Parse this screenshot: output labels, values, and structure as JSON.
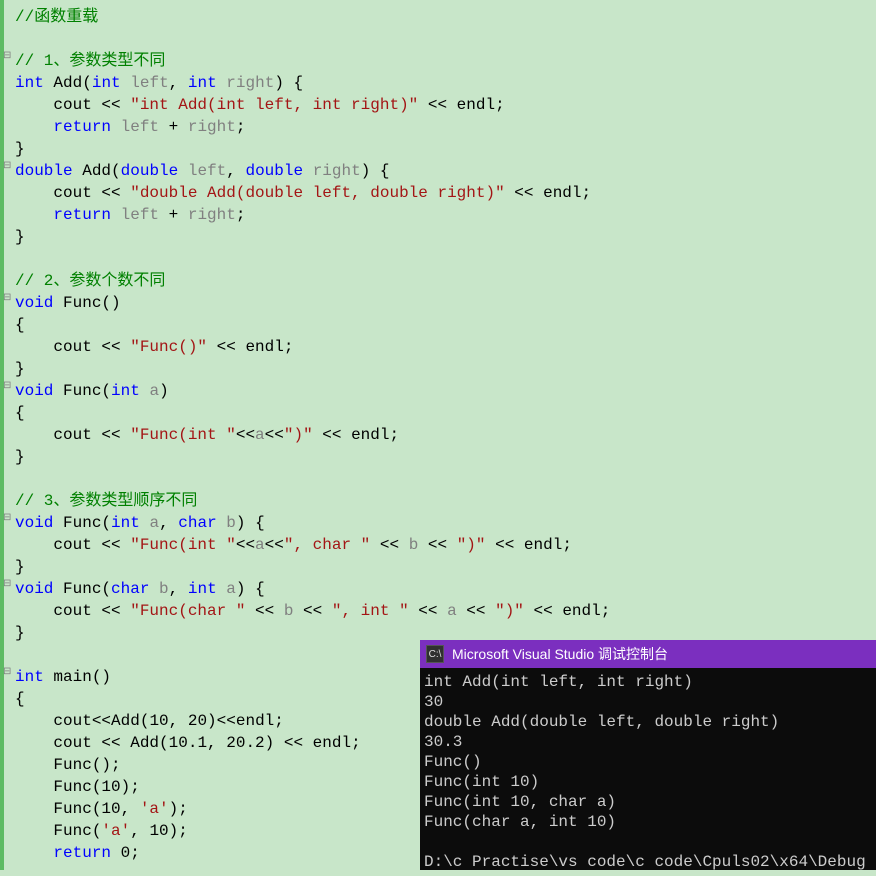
{
  "code": {
    "comment_overload": "//函数重载",
    "comment_1": "// 1、参数类型不同",
    "comment_2": "// 2、参数个数不同",
    "comment_3": "// 3、参数类型顺序不同",
    "kw_int": "int",
    "kw_double": "double",
    "kw_void": "void",
    "kw_char": "char",
    "kw_return": "return",
    "fn_add": "Add",
    "fn_func": "Func",
    "fn_main": "main",
    "id_cout": "cout",
    "id_endl": "endl",
    "id_left": "left",
    "id_right": "right",
    "id_a": "a",
    "id_b": "b",
    "str_intadd": "\"int Add(int left, int right)\"",
    "str_doubleadd": "\"double Add(double left, double right)\"",
    "str_func0": "\"Func()\"",
    "str_funcint_open": "\"Func(int \"",
    "str_closeparen": "\")\"",
    "str_commachar": "\", char \"",
    "str_funcchar_open": "\"Func(char \"",
    "str_commaint": "\", int \"",
    "lit_charA": "'a'",
    "num_10": "10",
    "num_20": "20",
    "num_101": "10.1",
    "num_202": "20.2",
    "num_0": "0"
  },
  "console": {
    "title": "Microsoft Visual Studio 调试控制台",
    "lines": [
      "int Add(int left, int right)",
      "30",
      "double Add(double left, double right)",
      "30.3",
      "Func()",
      "Func(int 10)",
      "Func(int 10, char a)",
      "Func(char a, int 10)",
      "",
      "D:\\c Practise\\vs code\\c code\\Cpuls02\\x64\\Debug"
    ]
  },
  "gutter": {
    "marks": [
      {
        "line": 3,
        "sym": "⊟"
      },
      {
        "line": 7,
        "sym": "⊟"
      },
      {
        "line": 13,
        "sym": "⊟"
      },
      {
        "line": 17,
        "sym": "⊟"
      },
      {
        "line": 23,
        "sym": "⊟"
      },
      {
        "line": 26,
        "sym": "⊟"
      },
      {
        "line": 30,
        "sym": "⊟"
      }
    ]
  }
}
